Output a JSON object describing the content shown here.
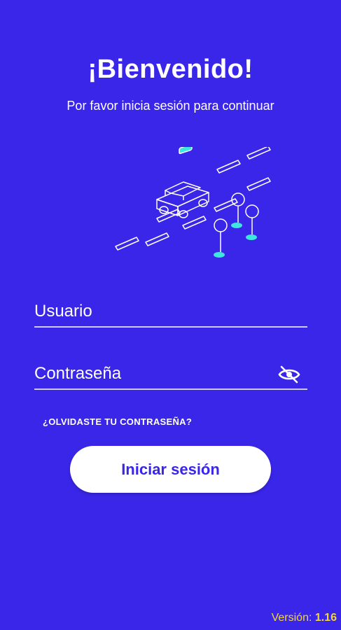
{
  "header": {
    "title": "¡Bienvenido!",
    "subtitle": "Por favor inicia sesión para continuar"
  },
  "illustration": {
    "icon": "taxi-route-illustration",
    "accent_color": "#3ee6e0"
  },
  "form": {
    "username_placeholder": "Usuario",
    "password_placeholder": "Contraseña",
    "password_toggle_icon": "eye-off-icon",
    "forgot_password_label": "¿OLVIDASTE TU CONTRASEÑA?",
    "login_button_label": "Iniciar sesión"
  },
  "footer": {
    "version_label": "Versión:",
    "version_number": "1.16"
  },
  "colors": {
    "background": "#3a26e8",
    "button_text": "#3a26e8",
    "version_text": "#f2d53c"
  }
}
